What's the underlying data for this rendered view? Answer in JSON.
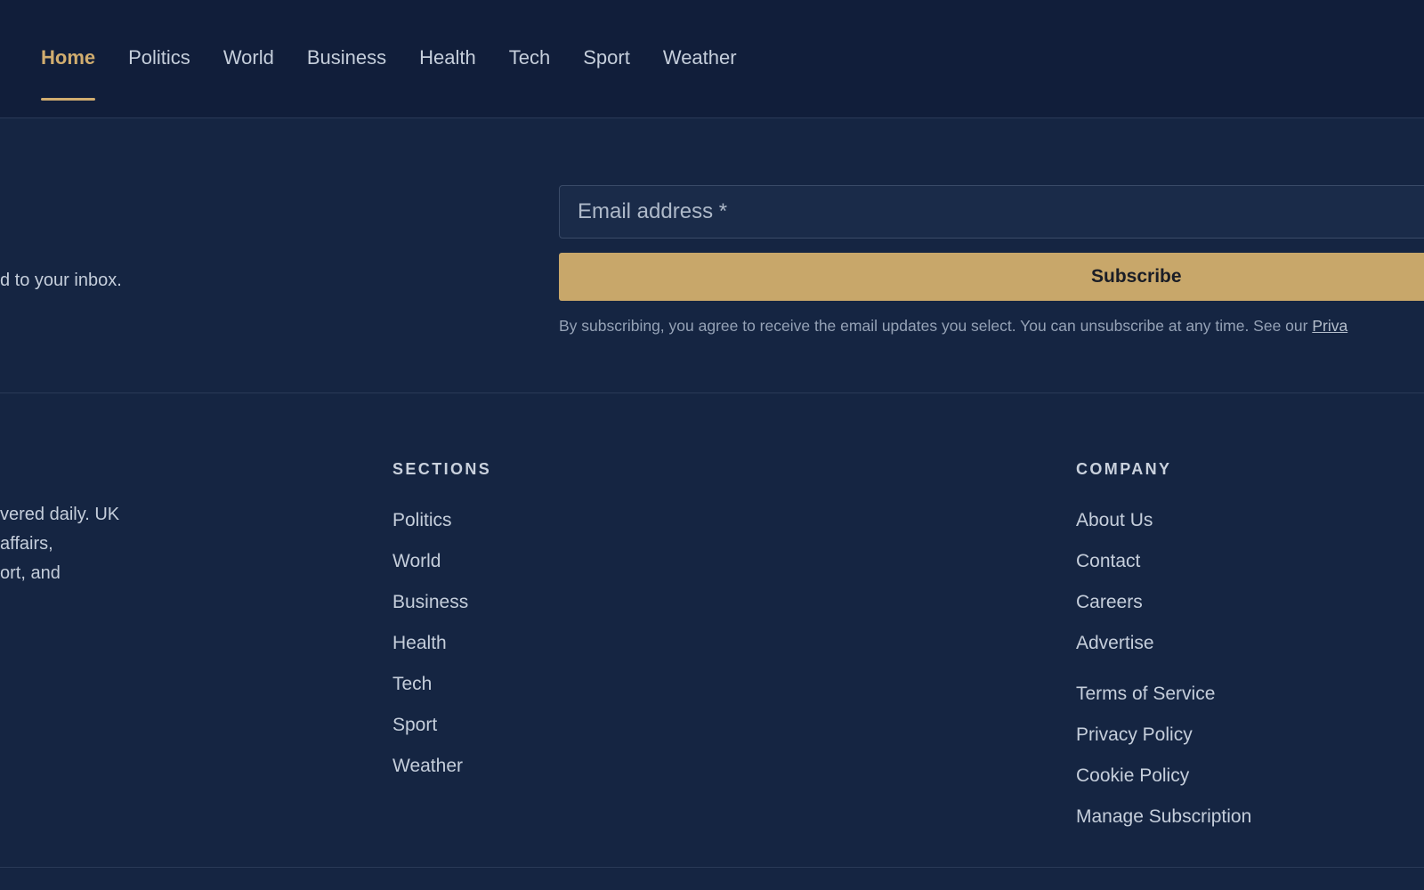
{
  "nav": {
    "items": [
      {
        "label": "Home",
        "active": true
      },
      {
        "label": "Politics"
      },
      {
        "label": "World"
      },
      {
        "label": "Business"
      },
      {
        "label": "Health"
      },
      {
        "label": "Tech"
      },
      {
        "label": "Sport"
      },
      {
        "label": "Weather"
      }
    ]
  },
  "newsletter": {
    "tagline_partial": "d to your inbox.",
    "email_placeholder": "Email address *",
    "subscribe_label": "Subscribe",
    "disclaimer": "By subscribing, you agree to receive the email updates you select. You can unsubscribe at any time. See our ",
    "privacy_link_partial": "Priva"
  },
  "footer": {
    "about_text_partial": "vered daily. UK\naffairs,\nort, and",
    "sections": {
      "heading": "SECTIONS",
      "links": [
        "Politics",
        "World",
        "Business",
        "Health",
        "Tech",
        "Sport",
        "Weather"
      ]
    },
    "company": {
      "heading": "COMPANY",
      "links": [
        "About Us",
        "Contact",
        "Careers",
        "Advertise"
      ],
      "legal_links": [
        "Terms of Service",
        "Privacy Policy",
        "Cookie Policy",
        "Manage Subscription"
      ]
    }
  },
  "colors": {
    "nav_bg": "#111e3a",
    "page_bg": "#152542",
    "accent_gold": "#d1ad6f",
    "button_gold": "#c8a76a"
  }
}
